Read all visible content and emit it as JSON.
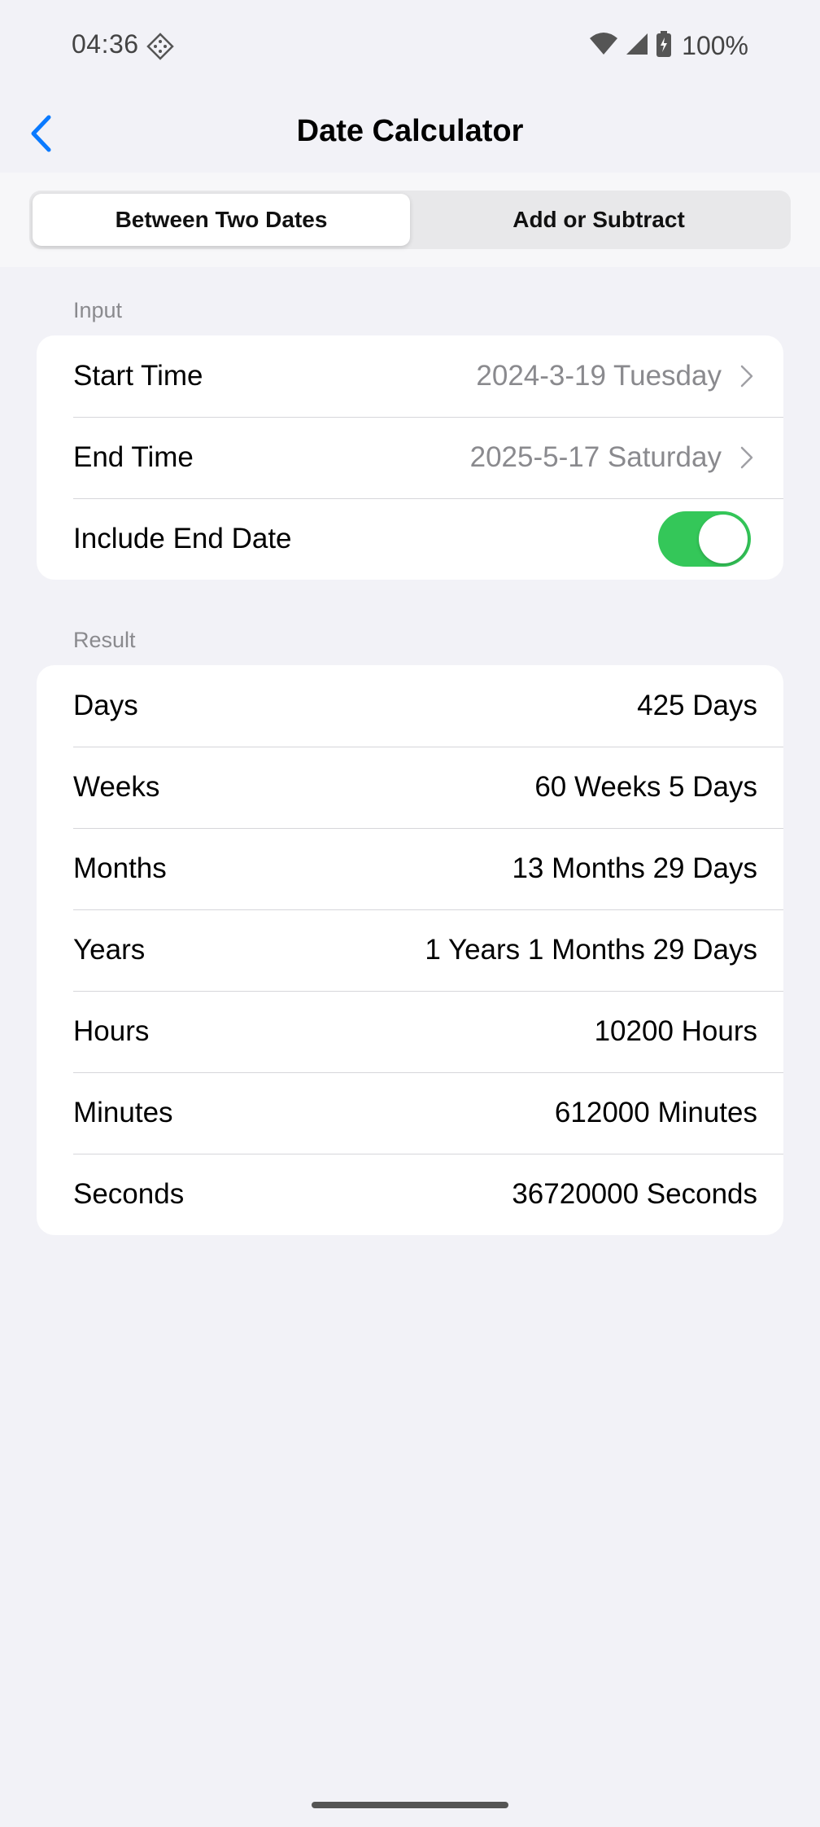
{
  "status_bar": {
    "time": "04:36",
    "battery": "100%",
    "icons": [
      "diamond-icon",
      "wifi-icon",
      "signal-icon",
      "battery-icon"
    ]
  },
  "nav": {
    "title": "Date Calculator",
    "back_icon": "chevron-left-icon"
  },
  "tabs": [
    {
      "label": "Between Two Dates",
      "active": true
    },
    {
      "label": "Add or Subtract",
      "active": false
    }
  ],
  "input": {
    "section_label": "Input",
    "start_time": {
      "label": "Start Time",
      "value": "2024-3-19 Tuesday"
    },
    "end_time": {
      "label": "End Time",
      "value": "2025-5-17 Saturday"
    },
    "include_end_date": {
      "label": "Include End Date",
      "on": true
    }
  },
  "result": {
    "section_label": "Result",
    "rows": [
      {
        "label": "Days",
        "value": "425 Days"
      },
      {
        "label": "Weeks",
        "value": "60 Weeks 5 Days"
      },
      {
        "label": "Months",
        "value": "13 Months 29 Days"
      },
      {
        "label": "Years",
        "value": "1 Years 1 Months 29 Days"
      },
      {
        "label": "Hours",
        "value": "10200 Hours"
      },
      {
        "label": "Minutes",
        "value": "612000 Minutes"
      },
      {
        "label": "Seconds",
        "value": "36720000 Seconds"
      }
    ]
  },
  "colors": {
    "accent": "#0a7aff",
    "toggle_on": "#34c759",
    "background": "#f2f2f7"
  }
}
